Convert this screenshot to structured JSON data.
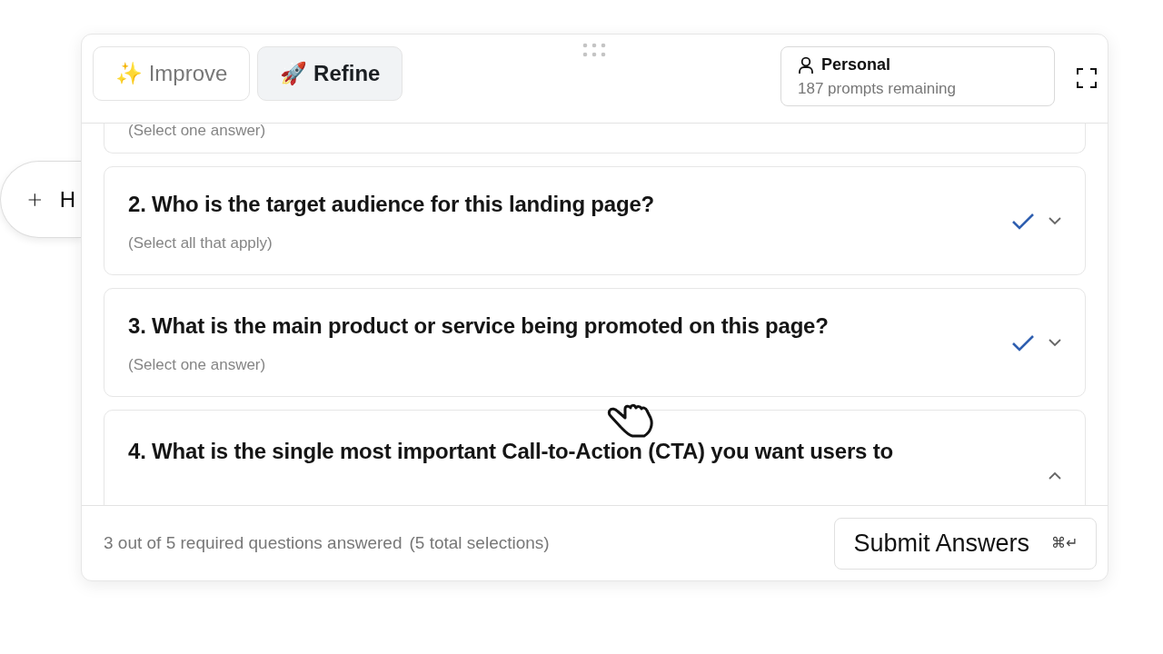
{
  "background_button": {
    "label": "H"
  },
  "tabs": [
    {
      "icon": "✨",
      "label": "Improve",
      "selected": false
    },
    {
      "icon": "🚀",
      "label": "Refine",
      "selected": true
    }
  ],
  "account": {
    "name": "Personal",
    "remaining": "187 prompts remaining"
  },
  "questions": [
    {
      "subtitle": "(Select one answer)"
    },
    {
      "title": "2. Who is the target audience for this landing page?",
      "subtitle": "(Select all that apply)",
      "answered": true,
      "expanded": false
    },
    {
      "title": "3. What is the main product or service being promoted on this page?",
      "subtitle": "(Select one answer)",
      "answered": true,
      "expanded": false
    },
    {
      "title": "4. What is the single most important Call-to-Action (CTA) you want users to",
      "answered": false,
      "expanded": true
    }
  ],
  "footer": {
    "progress": "3 out of 5 required questions answered",
    "selections": "(5 total selections)",
    "submit": "Submit Answers",
    "shortcut": "⌘↵"
  }
}
